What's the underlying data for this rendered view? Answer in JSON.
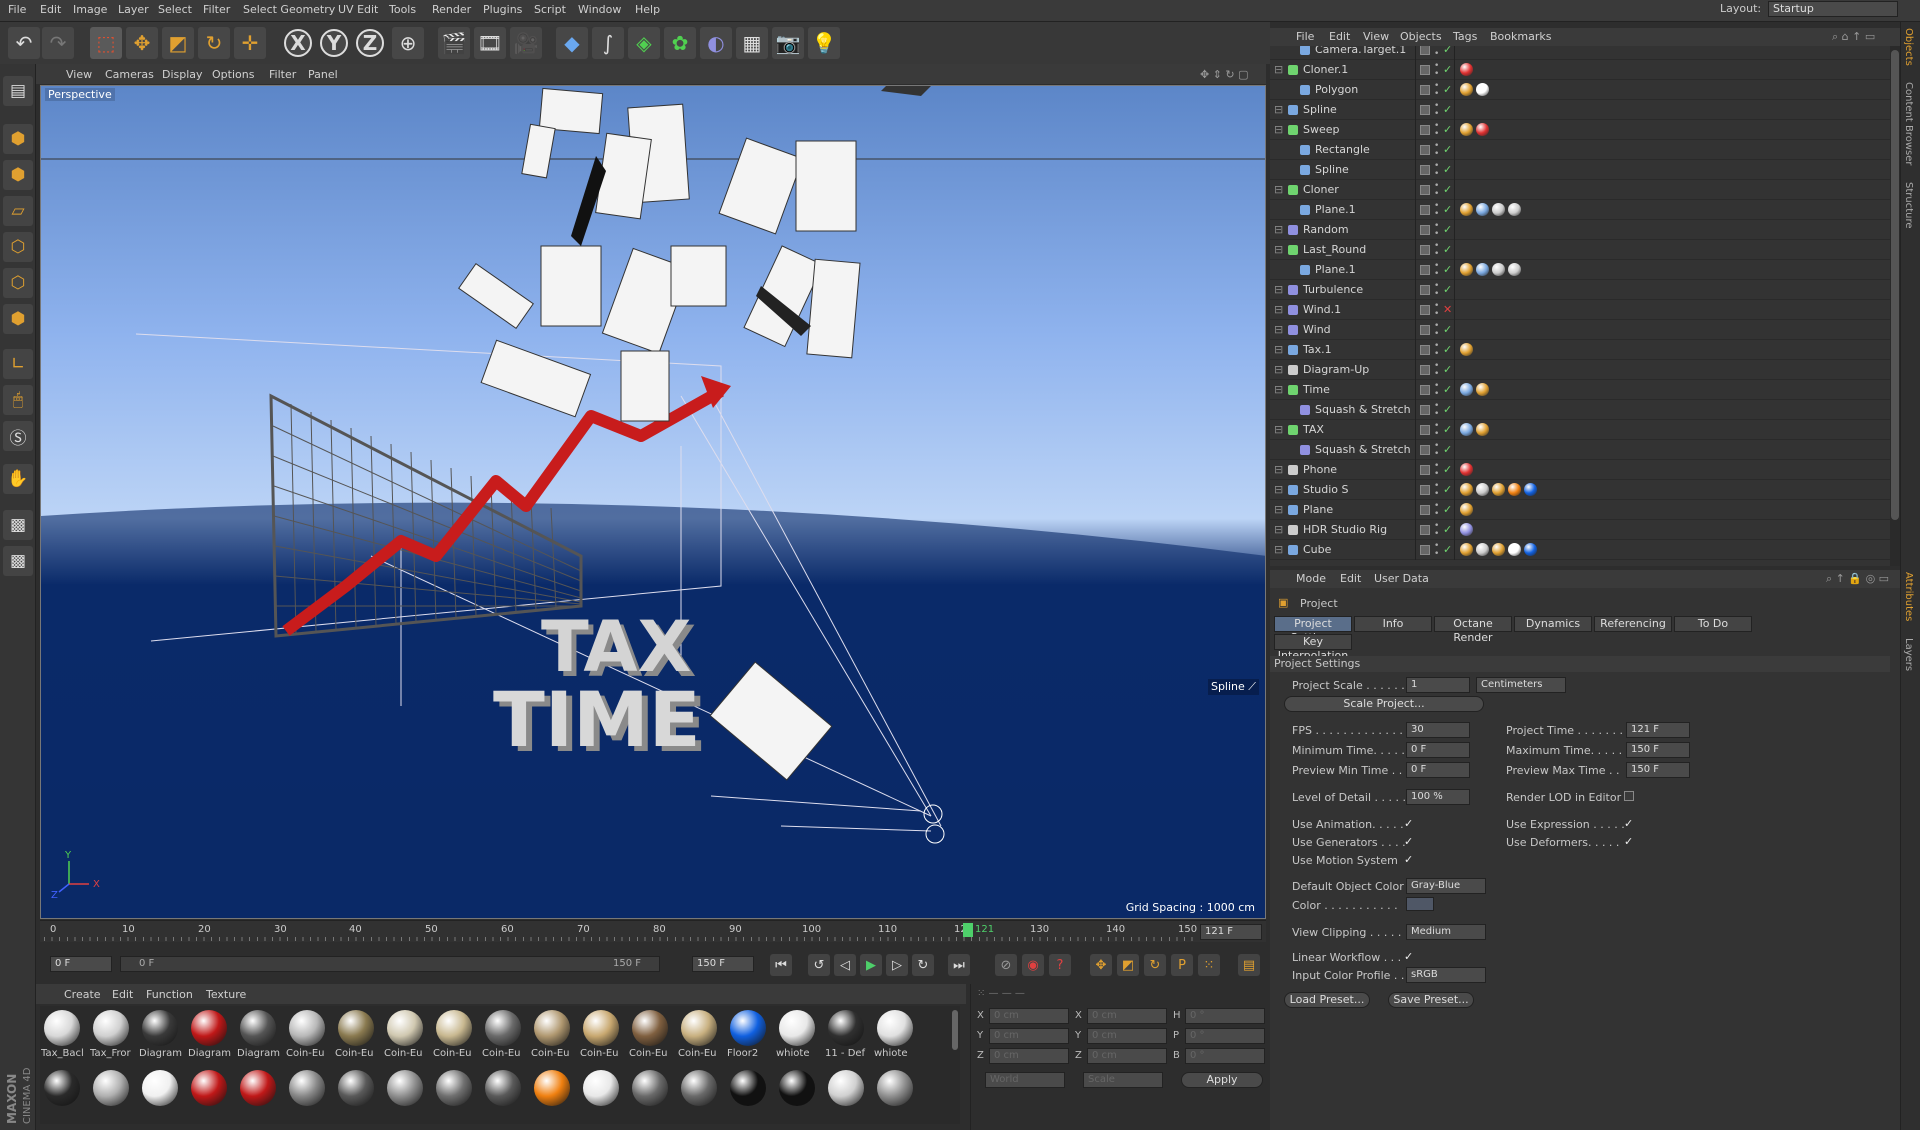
{
  "menubar": [
    "File",
    "Edit",
    "Image",
    "Layer",
    "Select",
    "Filter",
    "Select Geometry",
    "UV Edit",
    "Tools",
    "Render",
    "Plugins",
    "Script",
    "Window",
    "Help"
  ],
  "layout": {
    "label": "Layout:",
    "value": "Startup"
  },
  "toolbar": {
    "axes": [
      "X",
      "Y",
      "Z"
    ]
  },
  "viewport": {
    "menu": [
      "View",
      "Cameras",
      "Display",
      "Options",
      "Filter",
      "Panel"
    ],
    "label": "Perspective",
    "grid": "Grid Spacing : 1000 cm",
    "spline_label": "Spline",
    "scene_text": [
      "TAX",
      "TIME"
    ]
  },
  "timeline": {
    "ticks": [
      "0",
      "10",
      "20",
      "30",
      "40",
      "50",
      "60",
      "70",
      "80",
      "90",
      "100",
      "110",
      "120",
      "130",
      "140",
      "150"
    ],
    "current": "121",
    "field": "121 F"
  },
  "transport": {
    "start": "0 F",
    "range_start": "0 F",
    "range_end": "150 F",
    "end": "150 F"
  },
  "materials": {
    "menu": [
      "Create",
      "Edit",
      "Function",
      "Texture"
    ],
    "row1": [
      {
        "label": "Tax_Bacl",
        "color": "#d8d8d8"
      },
      {
        "label": "Tax_Fror",
        "color": "#d0d0d0"
      },
      {
        "label": "Diagram",
        "color": "#3a3a3a"
      },
      {
        "label": "Diagram",
        "color": "#c01818"
      },
      {
        "label": "Diagram",
        "color": "#555555"
      },
      {
        "label": "Coin-Eu",
        "color": "#b8b8b8"
      },
      {
        "label": "Coin-Eu",
        "color": "#8a7a50"
      },
      {
        "label": "Coin-Eu",
        "color": "#d0c8b0"
      },
      {
        "label": "Coin-Eu",
        "color": "#c8b890"
      },
      {
        "label": "Coin-Eu",
        "color": "#6a6a6a"
      },
      {
        "label": "Coin-Eu",
        "color": "#b09870"
      },
      {
        "label": "Coin-Eu",
        "color": "#c8a870"
      },
      {
        "label": "Coin-Eu",
        "color": "#806040"
      },
      {
        "label": "Coin-Eu",
        "color": "#c8b080"
      },
      {
        "label": "Floor2",
        "color": "#1060e0"
      },
      {
        "label": "whiote",
        "color": "#e8e8e8"
      },
      {
        "label": "11 - Def",
        "color": "#303030"
      },
      {
        "label": "whiote",
        "color": "#e0e0e0"
      }
    ],
    "row2": [
      "#2a2a2a",
      "#b0b0b0",
      "#f0f0f0",
      "#c01818",
      "#c01818",
      "#888888",
      "#5a5a5a",
      "#909090",
      "#707070",
      "#5a5a5a",
      "#f08010",
      "#e8e8e8",
      "#6a6a6a",
      "#6a6a6a",
      "#111111",
      "#111111",
      "#d0d0d0",
      "#909090"
    ]
  },
  "coords": {
    "rows": [
      [
        "X",
        "0 cm",
        "X",
        "0 cm",
        "H",
        "0 °"
      ],
      [
        "Y",
        "0 cm",
        "Y",
        "0 cm",
        "P",
        "0 °"
      ],
      [
        "Z",
        "0 cm",
        "Z",
        "0 cm",
        "B",
        "0 °"
      ]
    ],
    "world": "World",
    "scale": "Scale",
    "apply": "Apply"
  },
  "objects": {
    "menu": [
      "File",
      "Edit",
      "View",
      "Objects",
      "Tags",
      "Bookmarks"
    ],
    "rows": [
      {
        "name": "Camera.Target.1",
        "indent": 1,
        "icon": "#7aa8e0",
        "tags": []
      },
      {
        "name": "Cloner.1",
        "indent": 0,
        "icon": "#6fd46f",
        "tags": [
          "#e03030"
        ]
      },
      {
        "name": "Polygon",
        "indent": 1,
        "icon": "#7aa8e0",
        "tags": [
          "#e0a030",
          "#ffffff"
        ]
      },
      {
        "name": "Spline",
        "indent": 0,
        "icon": "#7aa8e0",
        "tags": []
      },
      {
        "name": "Sweep",
        "indent": 0,
        "icon": "#6fd46f",
        "tags": [
          "#e0a030",
          "#e03030"
        ]
      },
      {
        "name": "Rectangle",
        "indent": 1,
        "icon": "#7aa8e0",
        "tags": []
      },
      {
        "name": "Spline",
        "indent": 1,
        "icon": "#7aa8e0",
        "tags": []
      },
      {
        "name": "Cloner",
        "indent": 0,
        "icon": "#6fd46f",
        "tags": []
      },
      {
        "name": "Plane.1",
        "indent": 1,
        "icon": "#7aa8e0",
        "tags": [
          "#e0a030",
          "#7aa8e0",
          "#cccccc",
          "#cccccc"
        ]
      },
      {
        "name": "Random",
        "indent": 0,
        "icon": "#9090e0",
        "tags": []
      },
      {
        "name": "Last_Round",
        "indent": 0,
        "icon": "#6fd46f",
        "tags": []
      },
      {
        "name": "Plane.1",
        "indent": 1,
        "icon": "#7aa8e0",
        "tags": [
          "#e0a030",
          "#7aa8e0",
          "#cccccc",
          "#cccccc"
        ]
      },
      {
        "name": "Turbulence",
        "indent": 0,
        "icon": "#9090e0",
        "tags": []
      },
      {
        "name": "Wind.1",
        "indent": 0,
        "icon": "#9090e0",
        "tags": []
      },
      {
        "name": "Wind",
        "indent": 0,
        "icon": "#9090e0",
        "tags": []
      },
      {
        "name": "Tax.1",
        "indent": 0,
        "icon": "#7aa8e0",
        "tags": [
          "#e0a030"
        ]
      },
      {
        "name": "Diagram-Up",
        "indent": 0,
        "icon": "#cccccc",
        "tags": []
      },
      {
        "name": "Time",
        "indent": 0,
        "icon": "#6fd46f",
        "tags": [
          "#7aa8e0",
          "#e0a030"
        ]
      },
      {
        "name": "Squash & Stretch",
        "indent": 1,
        "icon": "#9090e0",
        "tags": []
      },
      {
        "name": "TAX",
        "indent": 0,
        "icon": "#6fd46f",
        "tags": [
          "#7aa8e0",
          "#e0a030"
        ]
      },
      {
        "name": "Squash & Stretch",
        "indent": 1,
        "icon": "#9090e0",
        "tags": []
      },
      {
        "name": "Phone",
        "indent": 0,
        "icon": "#cccccc",
        "tags": [
          "#e03030"
        ]
      },
      {
        "name": "Studio S",
        "indent": 0,
        "icon": "#7aa8e0",
        "tags": [
          "#e0a030",
          "#cccccc",
          "#e0a030",
          "#f08010",
          "#1060e0"
        ]
      },
      {
        "name": "Plane",
        "indent": 0,
        "icon": "#7aa8e0",
        "tags": [
          "#e0a030"
        ]
      },
      {
        "name": "HDR Studio Rig",
        "indent": 0,
        "icon": "#cccccc",
        "tags": [
          "#9090e0"
        ]
      },
      {
        "name": "Cube",
        "indent": 0,
        "icon": "#7aa8e0",
        "tags": [
          "#e0a030",
          "#cccccc",
          "#e0a030",
          "#ffffff",
          "#1060e0"
        ]
      }
    ]
  },
  "attributes": {
    "menu": [
      "Mode",
      "Edit",
      "User Data"
    ],
    "title": "Project",
    "tabs": [
      "Project Settings",
      "Info",
      "Octane Render",
      "Dynamics",
      "Referencing",
      "To Do"
    ],
    "tab2": "Key Interpolation",
    "section": "Project Settings",
    "project_scale": {
      "label": "Project Scale . . . . . .",
      "value": "1",
      "unit": "Centimeters"
    },
    "scale_btn": "Scale Project...",
    "fps": {
      "label": "FPS . . . . . . . . . . . . . .",
      "value": "30"
    },
    "project_time": {
      "label": "Project Time . . . . . . .",
      "value": "121 F"
    },
    "min_time": {
      "label": "Minimum Time. . . . .",
      "value": "0 F"
    },
    "max_time": {
      "label": "Maximum Time. . . . .",
      "value": "150 F"
    },
    "prev_min": {
      "label": "Preview Min Time . .",
      "value": "0 F"
    },
    "prev_max": {
      "label": "Preview Max Time . .",
      "value": "150 F"
    },
    "lod": {
      "label": "Level of Detail . . . . .",
      "value": "100 %"
    },
    "render_lod": "Render LOD in Editor",
    "use_anim": "Use Animation. . . . .",
    "use_expr": "Use Expression . . . . .",
    "use_gen": "Use Generators . . . .",
    "use_def": "Use Deformers. . . . .",
    "use_motion": "Use Motion System",
    "def_color": {
      "label": "Default Object Color",
      "value": "Gray-Blue"
    },
    "color": {
      "label": "Color . . . . . . . . . . ."
    },
    "clipping": {
      "label": "View Clipping . . . . .",
      "value": "Medium"
    },
    "linear": "Linear Workflow . . .",
    "input_profile": {
      "label": "Input Color Profile . .",
      "value": "sRGB"
    },
    "load": "Load Preset...",
    "save": "Save Preset..."
  },
  "right_tabs": [
    "Objects",
    "Content Browser",
    "Structure",
    "Attributes",
    "Layers"
  ],
  "logo": [
    "MAXON",
    "CINEMA 4D"
  ]
}
